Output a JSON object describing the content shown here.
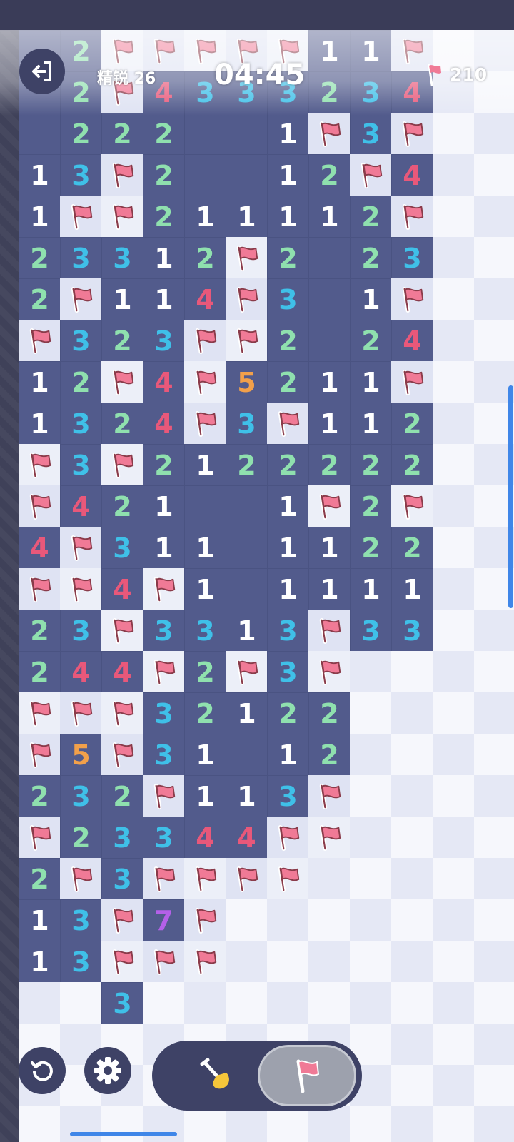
{
  "header": {
    "level_label": "精锐 26",
    "timer": "04:45",
    "flags_remaining": "210"
  },
  "board": {
    "cols": 12,
    "rows": 27,
    "colors": {
      "1": "#ffffff",
      "2": "#8fe0ae",
      "3": "#3fc0e8",
      "4": "#e8587a",
      "5": "#f2a04a",
      "6": "#2fc6b8",
      "7": "#b460e8",
      "8": "#9aa0b8"
    },
    "grid": [
      [
        "R",
        "2",
        "F",
        "F",
        "F",
        "F",
        "F",
        "1",
        "1",
        "F",
        "U",
        "U"
      ],
      [
        "R",
        "2",
        "F",
        "4",
        "3",
        "3",
        "3",
        "2",
        "3",
        "4",
        "U",
        "U"
      ],
      [
        "R",
        "2",
        "2",
        "2",
        "R",
        "R",
        "1",
        "F",
        "3",
        "F",
        "U",
        "U"
      ],
      [
        "1",
        "3",
        "F",
        "2",
        "R",
        "R",
        "1",
        "2",
        "F",
        "4",
        "U",
        "U"
      ],
      [
        "1",
        "F",
        "F",
        "2",
        "1",
        "1",
        "1",
        "1",
        "2",
        "F",
        "U",
        "U"
      ],
      [
        "2",
        "3",
        "3",
        "1",
        "2",
        "F",
        "2",
        "R",
        "2",
        "3",
        "U",
        "U"
      ],
      [
        "2",
        "F",
        "1",
        "1",
        "4",
        "F",
        "3",
        "R",
        "1",
        "F",
        "U",
        "U"
      ],
      [
        "F",
        "3",
        "2",
        "3",
        "F",
        "F",
        "2",
        "R",
        "2",
        "4",
        "U",
        "U"
      ],
      [
        "1",
        "2",
        "F",
        "4",
        "F",
        "5",
        "2",
        "1",
        "1",
        "F",
        "U",
        "U"
      ],
      [
        "1",
        "3",
        "2",
        "4",
        "F",
        "3",
        "F",
        "1",
        "1",
        "2",
        "U",
        "U"
      ],
      [
        "F",
        "3",
        "F",
        "2",
        "1",
        "2",
        "2",
        "2",
        "2",
        "2",
        "U",
        "U"
      ],
      [
        "F",
        "4",
        "2",
        "1",
        "R",
        "R",
        "1",
        "F",
        "2",
        "F",
        "U",
        "U"
      ],
      [
        "4",
        "F",
        "3",
        "1",
        "1",
        "R",
        "1",
        "1",
        "2",
        "2",
        "U",
        "U"
      ],
      [
        "F",
        "F",
        "4",
        "F",
        "1",
        "R",
        "1",
        "1",
        "1",
        "1",
        "U",
        "U"
      ],
      [
        "2",
        "3",
        "F",
        "3",
        "3",
        "1",
        "3",
        "F",
        "3",
        "3",
        "U",
        "U"
      ],
      [
        "2",
        "4",
        "4",
        "F",
        "2",
        "F",
        "3",
        "F",
        "U",
        "U",
        "U",
        "U"
      ],
      [
        "F",
        "F",
        "F",
        "3",
        "2",
        "1",
        "2",
        "2",
        "U",
        "U",
        "U",
        "U"
      ],
      [
        "F",
        "5",
        "F",
        "3",
        "1",
        "R",
        "1",
        "2",
        "U",
        "U",
        "U",
        "U"
      ],
      [
        "2",
        "3",
        "2",
        "F",
        "1",
        "1",
        "3",
        "F",
        "U",
        "U",
        "U",
        "U"
      ],
      [
        "F",
        "2",
        "3",
        "3",
        "4",
        "4",
        "F",
        "F",
        "U",
        "U",
        "U",
        "U"
      ],
      [
        "2",
        "F",
        "3",
        "F",
        "F",
        "F",
        "F",
        "U",
        "U",
        "U",
        "U",
        "U"
      ],
      [
        "1",
        "3",
        "F",
        "7",
        "F",
        "U",
        "U",
        "U",
        "U",
        "U",
        "U",
        "U"
      ],
      [
        "1",
        "3",
        "F",
        "F",
        "F",
        "U",
        "U",
        "U",
        "U",
        "U",
        "U",
        "U"
      ],
      [
        "U",
        "U",
        "3",
        "U",
        "U",
        "U",
        "U",
        "U",
        "U",
        "U",
        "U",
        "U"
      ],
      [
        "U",
        "U",
        "U",
        "U",
        "U",
        "U",
        "U",
        "U",
        "U",
        "U",
        "U",
        "U"
      ],
      [
        "U",
        "U",
        "U",
        "U",
        "U",
        "U",
        "U",
        "U",
        "U",
        "U",
        "U",
        "U"
      ],
      [
        "U",
        "U",
        "U",
        "U",
        "U",
        "U",
        "U",
        "U",
        "U",
        "U",
        "U",
        "U"
      ]
    ]
  },
  "controls": {
    "restart_icon": "restart-icon",
    "settings_icon": "gear-icon",
    "dig_icon": "shovel-icon",
    "flag_icon": "flag-icon",
    "active_mode": "flag"
  }
}
